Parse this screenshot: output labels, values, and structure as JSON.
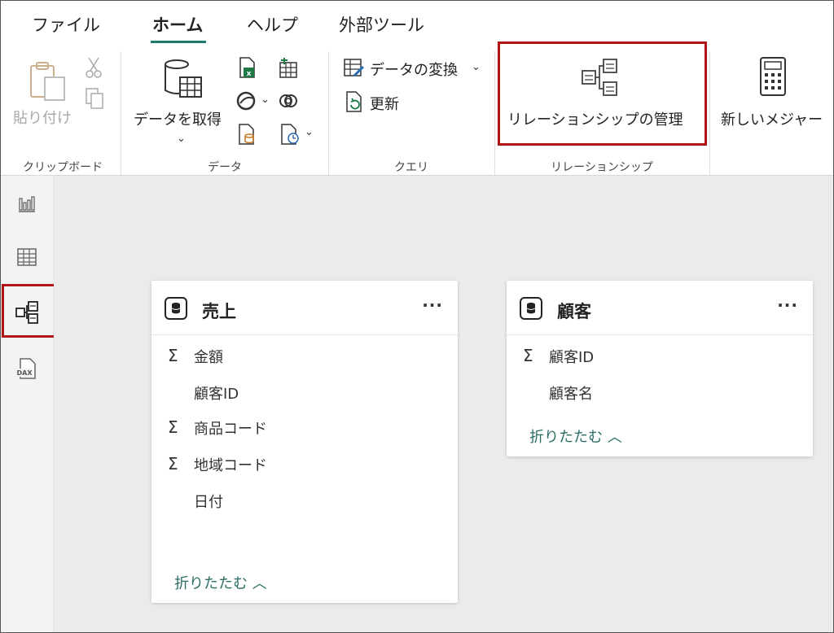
{
  "tabs": [
    {
      "label": "ファイル"
    },
    {
      "label": "ホーム"
    },
    {
      "label": "ヘルプ"
    },
    {
      "label": "外部ツール"
    }
  ],
  "ribbon": {
    "clipboard": {
      "paste_label": "貼り付け",
      "group_label": "クリップボード"
    },
    "data": {
      "get_data_label": "データを取得",
      "group_label": "データ"
    },
    "query": {
      "transform_label": "データの変換",
      "refresh_label": "更新",
      "group_label": "クエリ"
    },
    "relationship": {
      "manage_label": "リレーションシップの管理",
      "group_label": "リレーションシップ"
    },
    "measure": {
      "new_measure_label": "新しいメジャー"
    }
  },
  "rail": {
    "items": [
      "report-view-icon",
      "table-view-icon",
      "model-view-icon",
      "dax-query-icon"
    ],
    "dax_text": "DAX"
  },
  "tables": [
    {
      "title": "売上",
      "fields": [
        {
          "sigma": "Σ",
          "name": "金額"
        },
        {
          "sigma": "",
          "name": "顧客ID"
        },
        {
          "sigma": "Σ",
          "name": "商品コード"
        },
        {
          "sigma": "Σ",
          "name": "地域コード"
        },
        {
          "sigma": "",
          "name": "日付"
        }
      ],
      "collapse_label": "折りたたむ ︿",
      "more_label": "···"
    },
    {
      "title": "顧客",
      "fields": [
        {
          "sigma": "Σ",
          "name": "顧客ID"
        },
        {
          "sigma": "",
          "name": "顧客名"
        }
      ],
      "collapse_label": "折りたたむ ︿",
      "more_label": "···"
    }
  ],
  "colors": {
    "accent": "#1b7a6a",
    "highlight": "#b01515",
    "link": "#2c6e66"
  }
}
